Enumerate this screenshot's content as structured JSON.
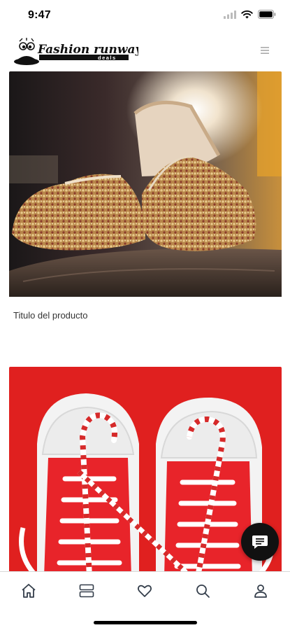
{
  "status_bar": {
    "time": "9:47"
  },
  "header": {
    "logo_text": "Fashion runway",
    "logo_subtext": "deals"
  },
  "products": [
    {
      "title": "Titulo del producto",
      "image": "gold-sequin-slippers-photo"
    },
    {
      "title": "",
      "image": "red-sneakers-candy-cane-laces-photo"
    }
  ],
  "bottom_nav": {
    "items": [
      {
        "icon": "home-icon"
      },
      {
        "icon": "catalog-icon"
      },
      {
        "icon": "heart-icon"
      },
      {
        "icon": "search-icon"
      },
      {
        "icon": "user-icon"
      }
    ]
  },
  "colors": {
    "accent": "#000000",
    "sneaker_background": "#e0201f",
    "nav_icon": "#333d4a"
  }
}
